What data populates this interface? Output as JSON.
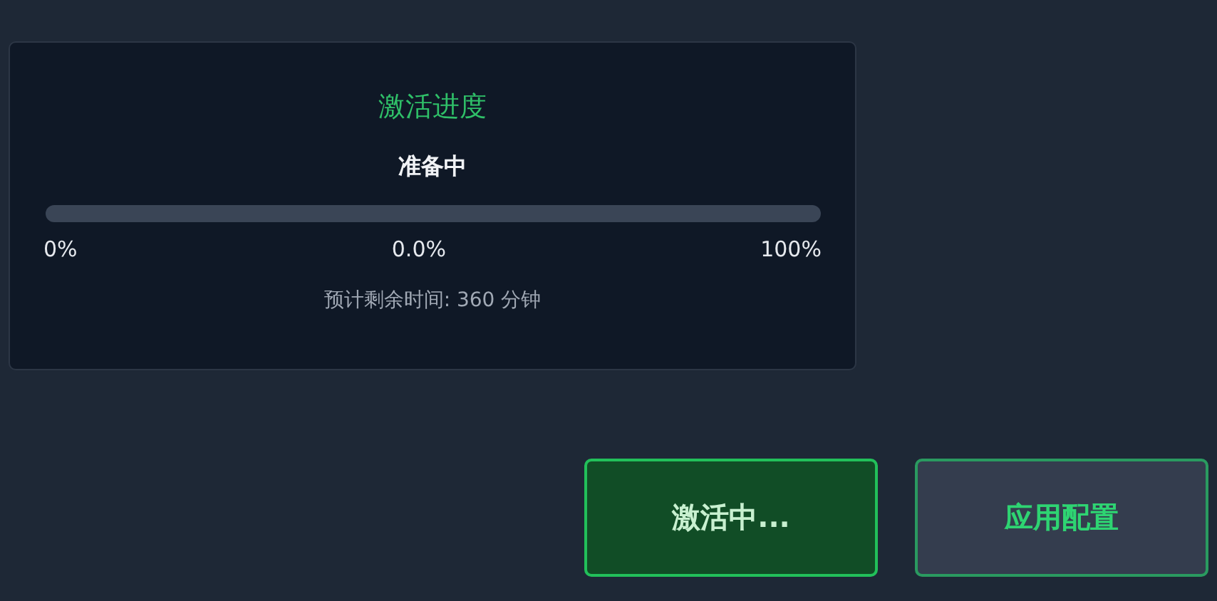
{
  "progress_panel": {
    "title": "激活进度",
    "status": "准备中",
    "level": 0,
    "min_label": "0%",
    "value_label": "0.0%",
    "max_label": "100%",
    "remaining_time": "预计剩余时间: 360 分钟"
  },
  "buttons": [
    {
      "label": "激活中...",
      "kind": "primary"
    },
    {
      "label": "应用配置",
      "kind": "secondary"
    }
  ]
}
